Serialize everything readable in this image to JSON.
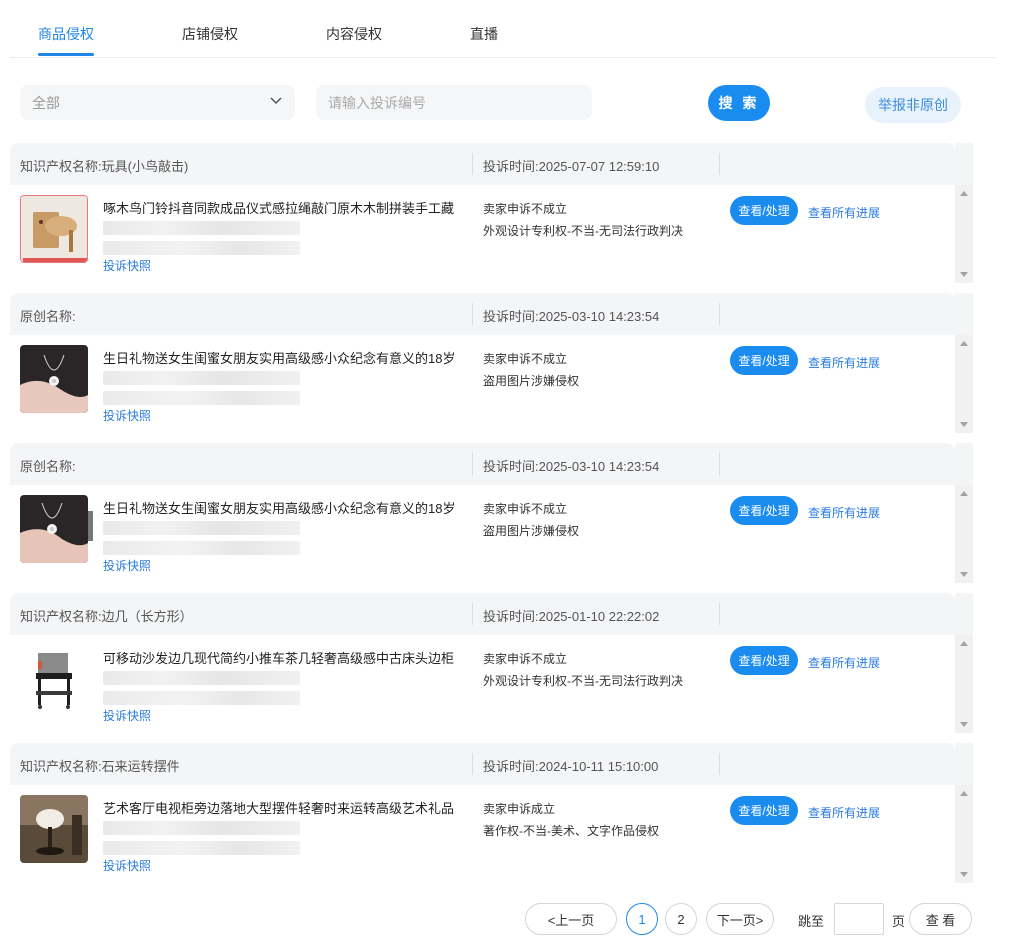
{
  "tabs": [
    {
      "label": "商品侵权",
      "active": true
    },
    {
      "label": "店铺侵权",
      "active": false
    },
    {
      "label": "内容侵权",
      "active": false
    },
    {
      "label": "直播",
      "active": false
    }
  ],
  "filter": {
    "select_value": "全部",
    "search_placeholder": "请输入投诉编号",
    "search_button": "搜 索",
    "report_button": "举报非原创"
  },
  "records": [
    {
      "header_name": "知识产权名称:玩具(小鸟敲击)",
      "complaint_time": "投诉时间:2025-07-07 12:59:10",
      "product_title": "啄木鸟门铃抖音同款成品仪式感拉绳敲门原木木制拼装手工藏",
      "snapshot_link": "投诉快照",
      "status": "卖家申诉不成立",
      "reason": "外观设计专利权-不当-无司法行政判决",
      "view_button": "查看/处理",
      "progress_link": "查看所有进展"
    },
    {
      "header_name": "原创名称:",
      "complaint_time": "投诉时间:2025-03-10 14:23:54",
      "product_title": "生日礼物送女生闺蜜女朋友实用高级感小众纪念有意义的18岁",
      "snapshot_link": "投诉快照",
      "status": "卖家申诉不成立",
      "reason": "盗用图片涉嫌侵权",
      "view_button": "查看/处理",
      "progress_link": "查看所有进展"
    },
    {
      "header_name": "原创名称:",
      "complaint_time": "投诉时间:2025-03-10 14:23:54",
      "product_title": "生日礼物送女生闺蜜女朋友实用高级感小众纪念有意义的18岁",
      "snapshot_link": "投诉快照",
      "status": "卖家申诉不成立",
      "reason": "盗用图片涉嫌侵权",
      "view_button": "查看/处理",
      "progress_link": "查看所有进展"
    },
    {
      "header_name": "知识产权名称:边几（长方形）",
      "complaint_time": "投诉时间:2025-01-10 22:22:02",
      "product_title": "可移动沙发边几现代简约小推车茶几轻奢高级感中古床头边柜",
      "snapshot_link": "投诉快照",
      "status": "卖家申诉不成立",
      "reason": "外观设计专利权-不当-无司法行政判决",
      "view_button": "查看/处理",
      "progress_link": "查看所有进展"
    },
    {
      "header_name": "知识产权名称:石来运转摆件",
      "complaint_time": "投诉时间:2024-10-11 15:10:00",
      "product_title": "艺术客厅电视柜旁边落地大型摆件轻奢时来运转高级艺术礼品",
      "snapshot_link": "投诉快照",
      "status": "卖家申诉成立",
      "reason": "著作权-不当-美术、文字作品侵权",
      "view_button": "查看/处理",
      "progress_link": "查看所有进展"
    }
  ],
  "pagination": {
    "prev": "<上一页",
    "pages": [
      "1",
      "2"
    ],
    "current_page": "1",
    "next": "下一页>",
    "jump_label": "跳至",
    "page_unit": "页",
    "go_button": "查 看"
  },
  "colors": {
    "accent": "#1a8cf0",
    "link": "#2a7be0",
    "report_bg": "#e8f2fd"
  }
}
